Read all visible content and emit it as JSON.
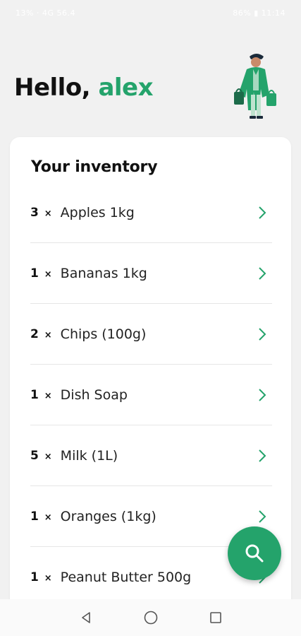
{
  "status_bar": {
    "left_text": "13% ⋅ 4G 56.4",
    "right_text": "86% ▮ 11:14"
  },
  "header": {
    "greeting": "Hello,",
    "user_name": "alex"
  },
  "inventory": {
    "title": "Your inventory",
    "items": [
      {
        "qty": "3",
        "name": "Apples 1kg"
      },
      {
        "qty": "1",
        "name": "Bananas 1kg"
      },
      {
        "qty": "2",
        "name": "Chips (100g)"
      },
      {
        "qty": "1",
        "name": "Dish Soap"
      },
      {
        "qty": "5",
        "name": "Milk (1L)"
      },
      {
        "qty": "1",
        "name": "Oranges (1kg)"
      },
      {
        "qty": "1",
        "name": "Peanut Butter 500g"
      }
    ],
    "qty_separator": "×"
  },
  "colors": {
    "accent": "#24a36b",
    "background": "#f1f1f1",
    "card": "#ffffff"
  },
  "icons": {
    "fab": "search-icon",
    "row": "chevron-right-icon",
    "nav": [
      "back-icon",
      "home-icon",
      "recents-icon"
    ]
  }
}
